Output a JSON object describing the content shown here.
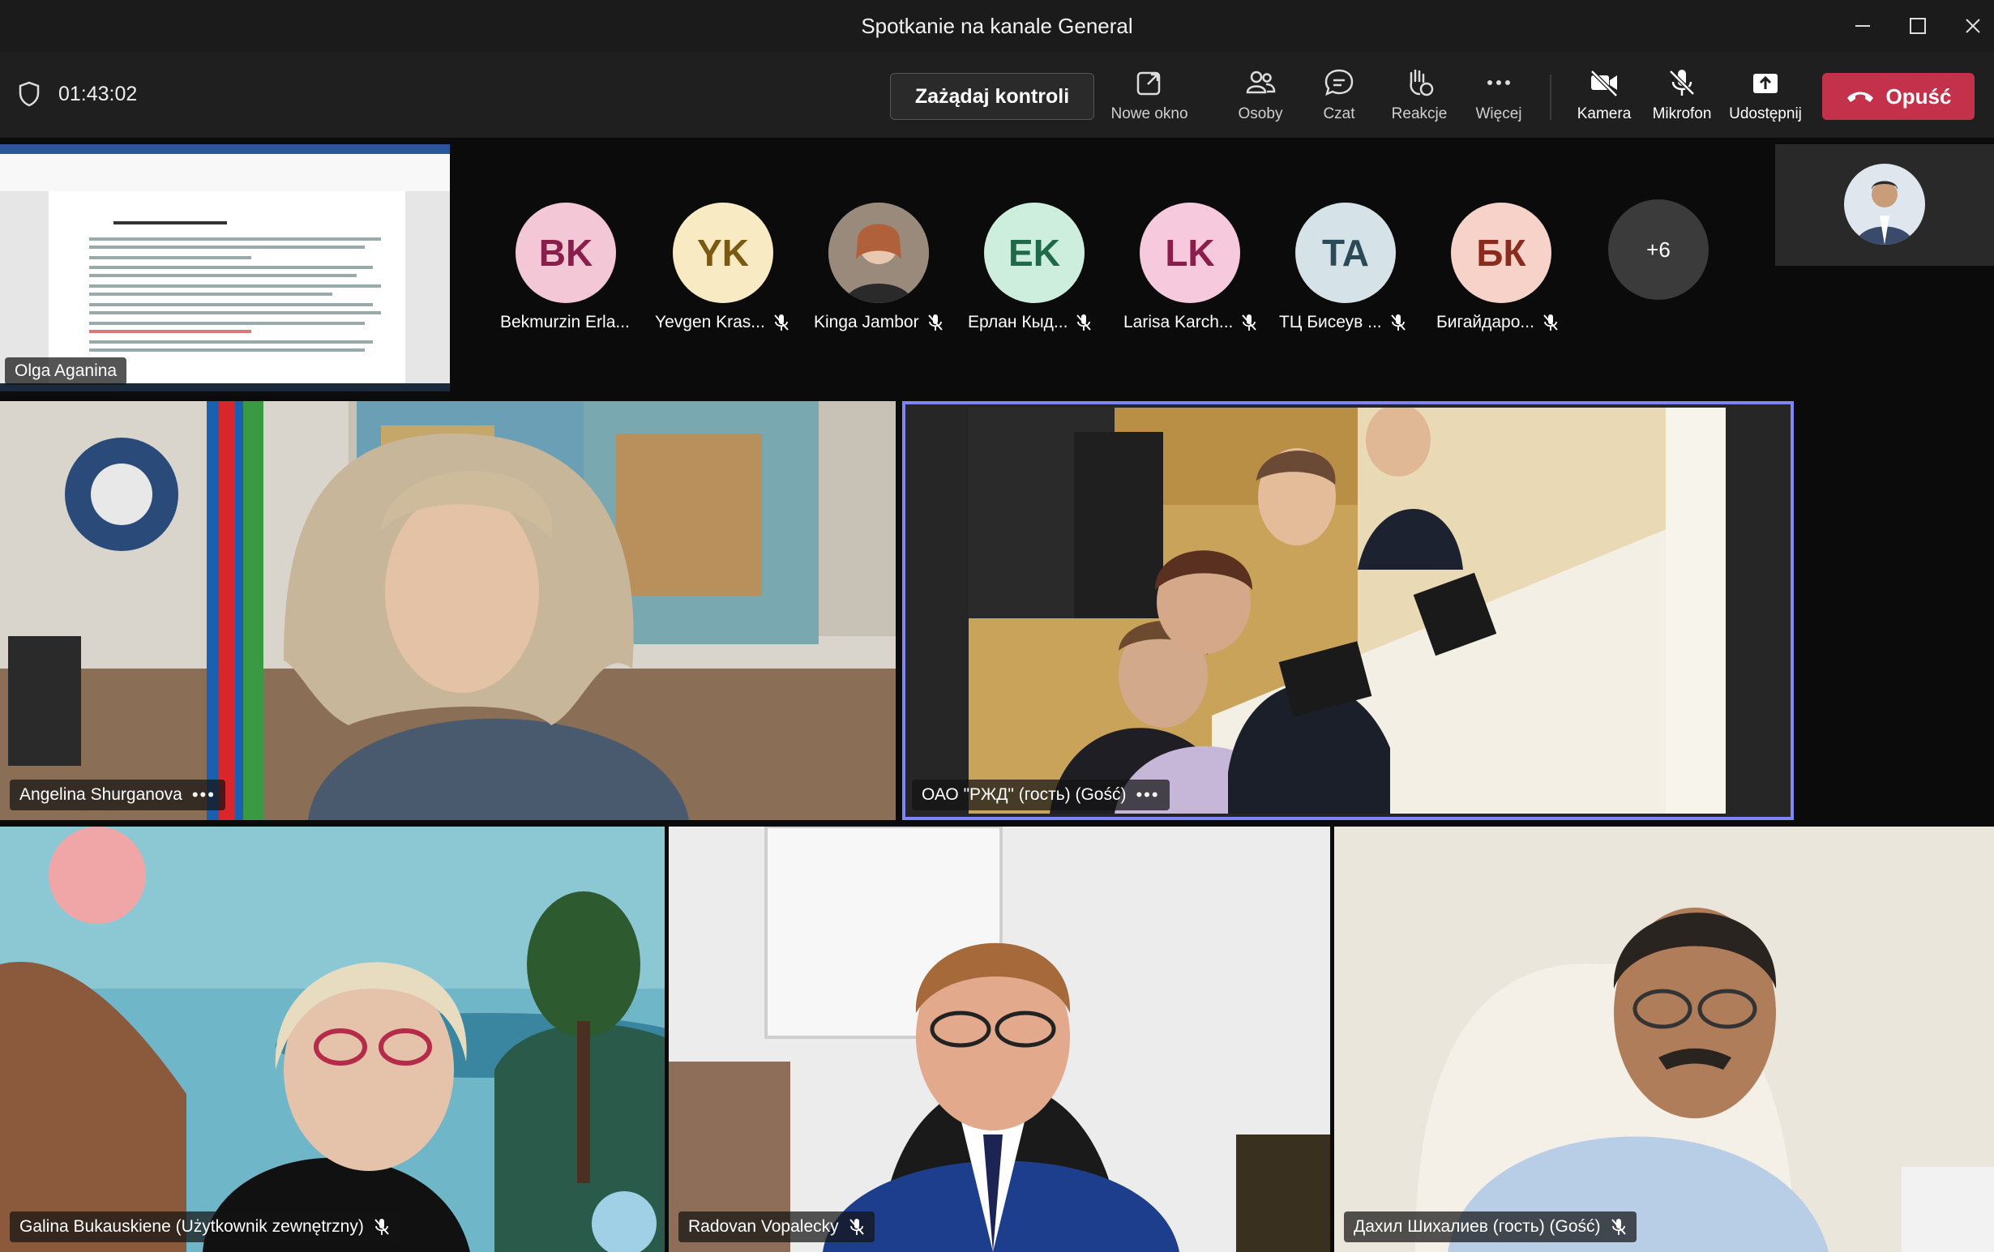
{
  "window": {
    "title": "Spotkanie na kanale General"
  },
  "toolbar": {
    "timer": "01:43:02",
    "request_control": "Zażądaj kontroli",
    "buttons": [
      {
        "label": "Nowe okno",
        "icon": "popout-icon"
      },
      {
        "label": "Osoby",
        "icon": "people-icon"
      },
      {
        "label": "Czat",
        "icon": "chat-icon"
      },
      {
        "label": "Reakcje",
        "icon": "reactions-icon"
      },
      {
        "label": "Więcej",
        "icon": "more-icon"
      },
      {
        "label": "Kamera",
        "icon": "camera-off-icon"
      },
      {
        "label": "Mikrofon",
        "icon": "mic-off-icon"
      },
      {
        "label": "Udostępnij",
        "icon": "share-icon"
      }
    ],
    "leave": "Opuść"
  },
  "shared_screen": {
    "presenter": "Olga Aganina"
  },
  "attendees": [
    {
      "initials": "BK",
      "name": "Bekmurzin Erla...",
      "bg": "#f3c7d6",
      "fg": "#8a1d4a",
      "muted": false
    },
    {
      "initials": "YK",
      "name": "Yevgen Kras...",
      "bg": "#f8ebc4",
      "fg": "#7a5a12",
      "muted": true
    },
    {
      "initials": "",
      "name": "Kinga Jambor",
      "bg": "#8c7b6d",
      "fg": "#fff",
      "muted": true
    },
    {
      "initials": "EK",
      "name": "Ерлан Кыд...",
      "bg": "#cdeedd",
      "fg": "#1e6a48",
      "muted": true
    },
    {
      "initials": "LK",
      "name": "Larisa Karch...",
      "bg": "#f6c9dd",
      "fg": "#8a1d4a",
      "muted": true
    },
    {
      "initials": "TA",
      "name": "ТЦ Бисеув ...",
      "bg": "#d5e3e8",
      "fg": "#2c4a56",
      "muted": true
    },
    {
      "initials": "БК",
      "name": "Бигайдаро...",
      "bg": "#f7d2c9",
      "fg": "#8a2c1d",
      "muted": true
    },
    {
      "initials": "+6",
      "name": "",
      "bg": "#3b3b3b",
      "fg": "#fff",
      "muted": false
    }
  ],
  "videos": {
    "v1": {
      "name": "Angelina Shurganova"
    },
    "v2": {
      "name": "ОАО \"РЖД\" (гость) (Gość)"
    },
    "v3": {
      "name": "Galina Bukauskiene (Użytkownik zewnętrzny)"
    },
    "v4": {
      "name": "Radovan Vopalecky"
    },
    "v5": {
      "name": "Дахил Шихалиев (гость) (Gość)"
    }
  }
}
